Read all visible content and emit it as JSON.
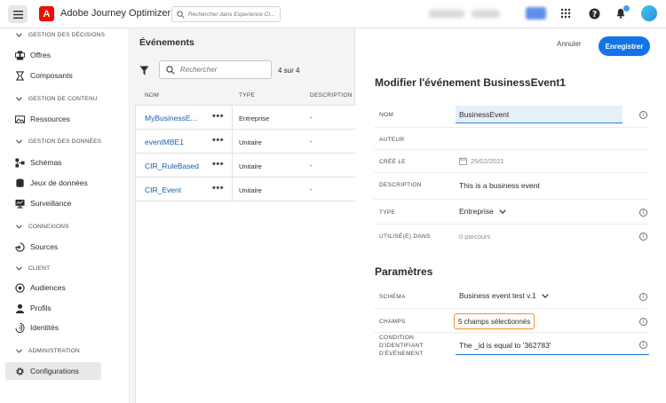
{
  "topbar": {
    "app_title": "Adobe Journey Optimizer",
    "search_placeholder": "Rechercher dans Experience Cl...",
    "brand_color": "#eb1000",
    "accent": "#1473e6"
  },
  "sidebar": {
    "sections": [
      {
        "title": "GESTION DES DÉCISIONS",
        "items": [
          {
            "label": "Offres",
            "icon": "offers-icon"
          },
          {
            "label": "Composants",
            "icon": "components-icon"
          }
        ]
      },
      {
        "title": "GESTION DE CONTENU",
        "items": [
          {
            "label": "Ressources",
            "icon": "assets-icon"
          }
        ]
      },
      {
        "title": "GESTION DES DONNÉES",
        "items": [
          {
            "label": "Schémas",
            "icon": "schema-icon"
          },
          {
            "label": "Jeux de données",
            "icon": "database-icon"
          },
          {
            "label": "Surveillance",
            "icon": "monitor-icon"
          }
        ]
      },
      {
        "title": "CONNEXIONS",
        "items": [
          {
            "label": "Sources",
            "icon": "sources-icon"
          }
        ]
      },
      {
        "title": "CLIENT",
        "items": [
          {
            "label": "Audiences",
            "icon": "audiences-icon"
          },
          {
            "label": "Profils",
            "icon": "profile-icon"
          },
          {
            "label": "Identités",
            "icon": "identity-icon"
          }
        ]
      },
      {
        "title": "ADMINISTRATION",
        "items": [
          {
            "label": "Configurations",
            "icon": "settings-icon",
            "active": true
          }
        ]
      }
    ]
  },
  "events": {
    "title": "Événements",
    "search_placeholder": "Rechercher",
    "count": "4 sur 4",
    "columns": [
      "NOM",
      "TYPE",
      "DESCRIPTION"
    ],
    "rows": [
      {
        "name": "MyBusinessE...",
        "type": "Entreprise",
        "description": "-"
      },
      {
        "name": "eventMBE1",
        "type": "Unitaire",
        "description": "-"
      },
      {
        "name": "CIR_RuleBased",
        "type": "Unitaire",
        "description": "-"
      },
      {
        "name": "CIR_Event",
        "type": "Unitaire",
        "description": "-"
      }
    ]
  },
  "detail": {
    "cancel_label": "Annuler",
    "save_label": "Enregistrer",
    "heading": "Modifier l'événement BusinessEvent1",
    "fields": {
      "nom_label": "NOM",
      "nom_value": "BusinessEvent",
      "auteur_label": "AUTEUR",
      "cree_label": "CRÉÉ LE",
      "cree_value": "25/02/2021",
      "desc_label": "DESCRIPTION",
      "desc_value": "This is a business event",
      "type_label": "TYPE",
      "type_value": "Entreprise",
      "util_label": "UTILISÉ(E) DANS",
      "util_value": "0 parcours"
    },
    "params_heading": "Paramètres",
    "params": {
      "schema_label": "SCHÉMA",
      "schema_value": "Business event test v.1",
      "champs_label": "CHAMPS",
      "champs_value": "5 champs sélectionnés",
      "cond_label_1": "CONDITION",
      "cond_label_2": "D'IDENTIFIANT",
      "cond_label_3": "D'ÉVÉNEMENT",
      "cond_value": "The _id is equal to '362783'"
    },
    "info_glyph": "i"
  }
}
